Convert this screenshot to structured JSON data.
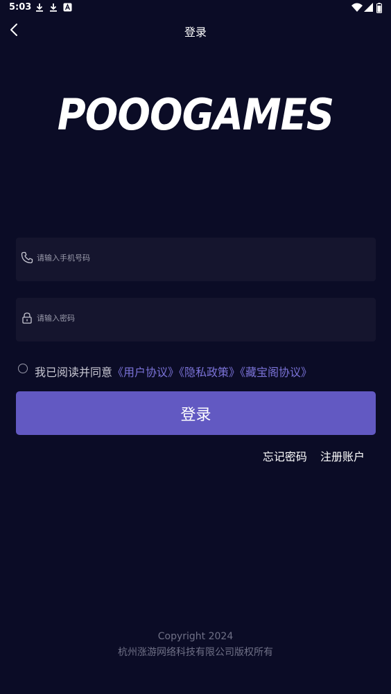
{
  "status_bar": {
    "time": "5:03",
    "icons": [
      "download-icon",
      "download-icon",
      "app-notification-icon",
      "wifi-icon",
      "cellular-signal-icon",
      "battery-icon"
    ]
  },
  "header": {
    "title": "登录",
    "back_icon": "chevron-left-icon"
  },
  "logo": {
    "text": "POOOGAMES"
  },
  "phone_field": {
    "icon": "phone-icon",
    "placeholder": "请输入手机号码",
    "value": ""
  },
  "password_field": {
    "icon": "lock-icon",
    "placeholder": "请输入密码",
    "value": ""
  },
  "agreement": {
    "checked": false,
    "prefix": "我已阅读并同意",
    "links": [
      "《用户协议》",
      "《隐私政策》",
      "《藏宝阁协议》"
    ]
  },
  "login_button": {
    "label": "登录"
  },
  "links": {
    "forgot_password": "忘记密码",
    "register": "注册账户"
  },
  "footer": {
    "copyright": "Copyright 2024",
    "company": "杭州涨游网络科技有限公司版权所有"
  },
  "colors": {
    "background": "#0b0c26",
    "field_background": "#15152e",
    "accent": "#6259c2",
    "link": "#7b73d8",
    "muted_text": "#6f7086"
  }
}
